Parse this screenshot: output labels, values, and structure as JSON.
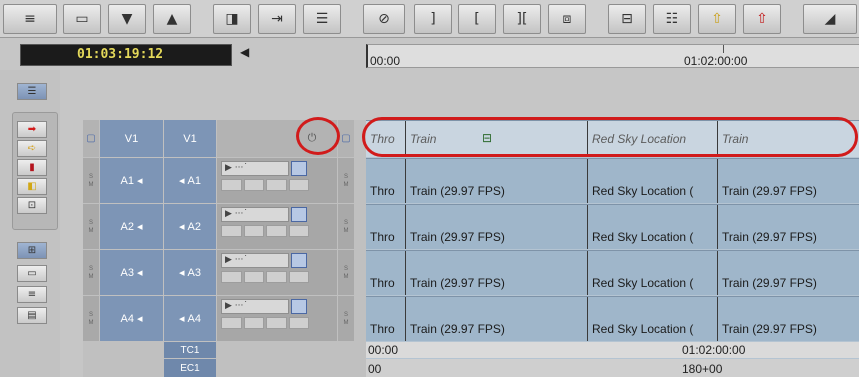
{
  "toolbar": {
    "buttons": [
      {
        "icon": "settings-sliders-icon",
        "glyph": "≡"
      },
      {
        "icon": "monitor-icon",
        "glyph": "▭"
      },
      {
        "icon": "triangle-down-icon",
        "glyph": "▼"
      },
      {
        "icon": "triangle-up-icon",
        "glyph": "▲"
      },
      {
        "icon": "panel-icon",
        "glyph": "◨"
      },
      {
        "icon": "insert-icon",
        "glyph": "⇥"
      },
      {
        "icon": "stack-icon",
        "glyph": "☰"
      },
      {
        "icon": "disable-icon",
        "glyph": "⊘"
      },
      {
        "icon": "mark-out-icon",
        "glyph": "]"
      },
      {
        "icon": "mark-in-icon",
        "glyph": "["
      },
      {
        "icon": "clear-marks-icon",
        "glyph": "]["
      },
      {
        "icon": "mark-clip-icon",
        "glyph": "⧈"
      },
      {
        "icon": "lift-icon",
        "glyph": "⊟"
      },
      {
        "icon": "extract-icon",
        "glyph": "☷"
      },
      {
        "icon": "lift-up-icon",
        "glyph": "⇧"
      },
      {
        "icon": "extract-up-icon",
        "glyph": "⇧"
      },
      {
        "icon": "overflow-icon",
        "glyph": "◢"
      }
    ]
  },
  "timecode": {
    "display": "01:03:19:12"
  },
  "ruler": {
    "start": "00:00",
    "mid": "01:02:00:00"
  },
  "tracks": {
    "video": {
      "source": "V1",
      "record": "V1"
    },
    "audio": [
      {
        "source": "A1",
        "record": "A1"
      },
      {
        "source": "A2",
        "record": "A2"
      },
      {
        "source": "A3",
        "record": "A3"
      },
      {
        "source": "A4",
        "record": "A4"
      }
    ],
    "tc1": "TC1",
    "ec1": "EC1"
  },
  "clips": {
    "video": [
      "Thro",
      "Train",
      "Red Sky Location",
      "Train"
    ],
    "audio": [
      "Thro",
      "Train (29.97 FPS)",
      "Red Sky Location (",
      "Train (29.97 FPS)"
    ]
  },
  "tc_row": {
    "start": "00:00",
    "mid": "01:02:00:00"
  },
  "ec_row": {
    "start": "00",
    "mid": "180+00"
  },
  "audio_tiny_labels": {
    "s": "S",
    "m": "M"
  }
}
